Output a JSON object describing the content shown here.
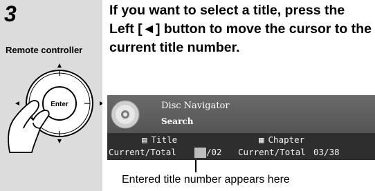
{
  "step": {
    "number": "3",
    "remote_label": "Remote controller",
    "enter_label": "Enter",
    "instruction": "If you want to select a title, press the Left [◄] button to move the cursor to the current title number."
  },
  "screen": {
    "title": "Disc Navigator",
    "subtitle": "Search",
    "title_header": "Title",
    "chapter_header": "Chapter",
    "title_current_label": "Current/Total",
    "title_total": "/02",
    "chapter_current_label": "Current/Total",
    "chapter_value": "03/38"
  },
  "caption": "Entered title number appears here",
  "colors": {
    "left_column": "#dcdcdc",
    "screen_header": "#5e5e5e",
    "screen_rows": "#2e2e2e",
    "cursor": "#bdbdbd"
  }
}
